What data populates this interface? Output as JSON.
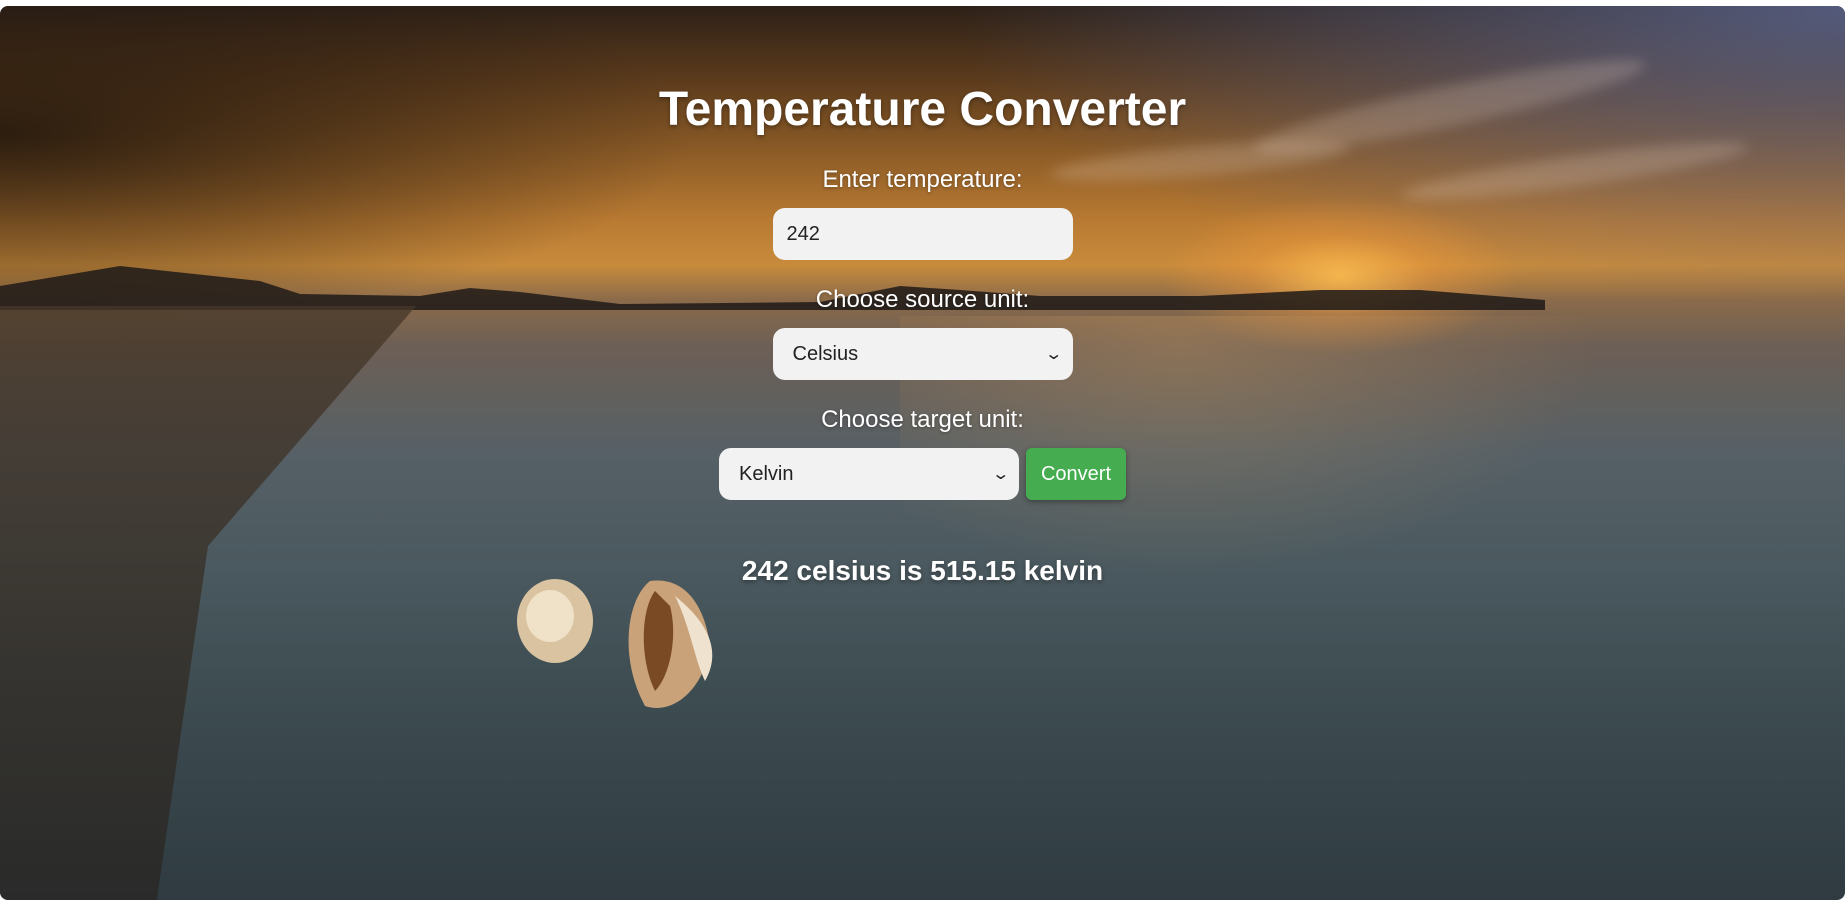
{
  "title": "Temperature Converter",
  "temperature": {
    "label": "Enter temperature:",
    "value": "242"
  },
  "source_unit": {
    "label": "Choose source unit:",
    "selected": "Celsius"
  },
  "target_unit": {
    "label": "Choose target unit:",
    "selected": "Kelvin"
  },
  "convert_button": {
    "label": "Convert"
  },
  "result": {
    "text": "242 celsius is 515.15 kelvin"
  },
  "colors": {
    "button": "#45ad4f",
    "text": "#ffffff",
    "field_bg": "#f2f2f2"
  },
  "icons": {
    "select_arrow": "chevron-down-icon"
  }
}
